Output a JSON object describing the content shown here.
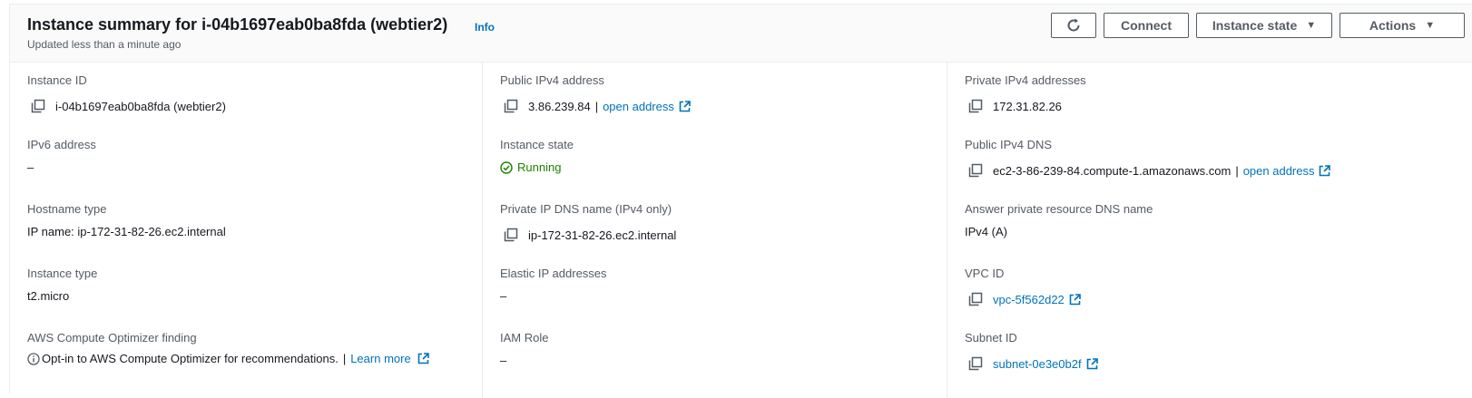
{
  "header": {
    "title": "Instance summary for i-04b1697eab0ba8fda (webtier2)",
    "info_label": "Info",
    "subtitle": "Updated less than a minute ago",
    "connect_label": "Connect",
    "instance_state_label": "Instance state",
    "actions_label": "Actions"
  },
  "fields": {
    "instance_id": {
      "label": "Instance ID",
      "value": "i-04b1697eab0ba8fda (webtier2)"
    },
    "ipv6": {
      "label": "IPv6 address",
      "value": "–"
    },
    "hostname_type": {
      "label": "Hostname type",
      "value": "IP name: ip-172-31-82-26.ec2.internal"
    },
    "instance_type": {
      "label": "Instance type",
      "value": "t2.micro"
    },
    "optimizer": {
      "label": "AWS Compute Optimizer finding",
      "value": "Opt-in to AWS Compute Optimizer for recommendations.",
      "separator": "|",
      "link": "Learn more"
    },
    "public_ipv4": {
      "label": "Public IPv4 address",
      "value": "3.86.239.84",
      "separator": "|",
      "link": "open address"
    },
    "instance_state": {
      "label": "Instance state",
      "value": "Running"
    },
    "private_dns": {
      "label": "Private IP DNS name (IPv4 only)",
      "value": "ip-172-31-82-26.ec2.internal"
    },
    "elastic_ip": {
      "label": "Elastic IP addresses",
      "value": "–"
    },
    "iam_role": {
      "label": "IAM Role",
      "value": "–"
    },
    "private_ipv4": {
      "label": "Private IPv4 addresses",
      "value": "172.31.82.26"
    },
    "public_dns": {
      "label": "Public IPv4 DNS",
      "value": "ec2-3-86-239-84.compute-1.amazonaws.com",
      "separator": "|",
      "link": "open address"
    },
    "answer_dns": {
      "label": "Answer private resource DNS name",
      "value": "IPv4 (A)"
    },
    "vpc_id": {
      "label": "VPC ID",
      "value": "vpc-5f562d22"
    },
    "subnet_id": {
      "label": "Subnet ID",
      "value": "subnet-0e3e0b2f"
    }
  },
  "icons": {
    "copy": "copy-icon",
    "external": "external-link-icon",
    "refresh": "refresh-icon",
    "status": "check-circle-icon",
    "info": "info-circle-icon",
    "caret": "caret-down-icon"
  },
  "colors": {
    "link": "#0073bb",
    "running": "#1d8102",
    "label": "#545b64",
    "text": "#16191f"
  }
}
